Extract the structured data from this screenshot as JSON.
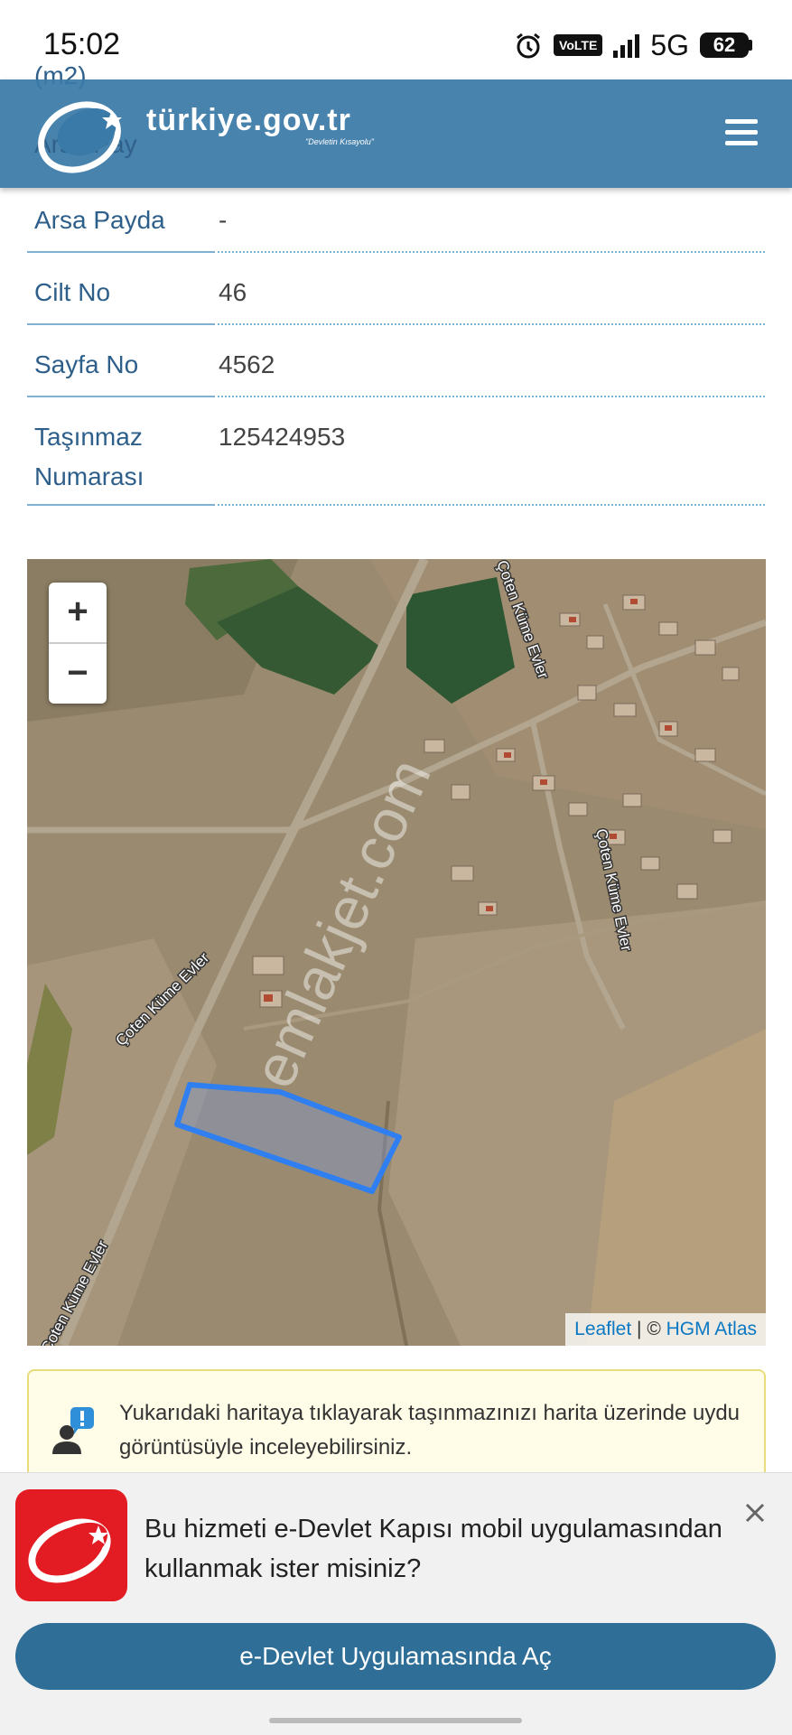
{
  "status_bar": {
    "time": "15:02",
    "volte": "VoLTE",
    "network": "5G",
    "battery": "62"
  },
  "ghost": {
    "row1": "(m2)",
    "row2": "Arsa Pay"
  },
  "header": {
    "title": "türkiye.gov.tr",
    "slogan": "\"Devletin Kısayolu\""
  },
  "rows": [
    {
      "label": "Arsa Payda",
      "value": "-"
    },
    {
      "label": "Cilt No",
      "value": "46"
    },
    {
      "label": "Sayfa No",
      "value": "4562"
    },
    {
      "label": "Taşınmaz",
      "label2": "Numarası",
      "value": "125424953"
    }
  ],
  "map": {
    "zoom_in": "+",
    "zoom_out": "−",
    "road_labels": [
      "Çoten Küme Evler",
      "Çoten Küme Evler",
      "Çoten Küme Evler",
      "Çoten Küme Evler"
    ],
    "watermark": "emlakjet.com",
    "attribution": {
      "leaflet": "Leaflet",
      "sep": " | © ",
      "hgm": "HGM Atlas"
    },
    "parcel_color": "#2f7ff0"
  },
  "notice": {
    "text": "Yukarıdaki haritaya tıklayarak taşınmazınızı harita üzerinde uydu görüntüsüyle inceleyebilirsiniz."
  },
  "promo": {
    "text": "Bu hizmeti e-Devlet Kapısı mobil uygulamasından kullanmak ister misiniz?",
    "button": "e-Devlet Uygulamasında Aç"
  },
  "colors": {
    "header": "#3a7aa8",
    "label": "#2e5f8a",
    "button": "#2f6f97",
    "app_icon": "#e31b23"
  }
}
